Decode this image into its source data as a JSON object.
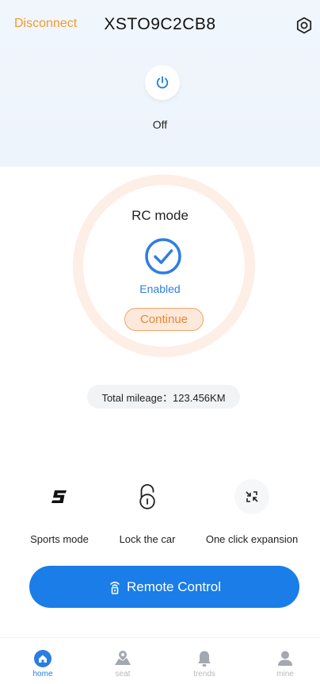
{
  "header": {
    "disconnect_label": "Disconnect",
    "device_id": "XSTO9C2CB8"
  },
  "power": {
    "state": "Off"
  },
  "rc_panel": {
    "title": "RC mode",
    "status": "Enabled",
    "continue_label": "Continue"
  },
  "mileage": {
    "text": "Total mileage：123.456KM"
  },
  "features": [
    {
      "label": "Sports mode",
      "icon": "sports-mode-icon"
    },
    {
      "label": "Lock the car",
      "icon": "lock-icon"
    },
    {
      "label": "One click expansion",
      "icon": "expand-icon"
    }
  ],
  "remote": {
    "label": "Remote Control",
    "icon": "remote-icon"
  },
  "tabs": [
    {
      "label": "home",
      "icon": "home-icon",
      "active": true
    },
    {
      "label": "seat",
      "icon": "map-icon"
    },
    {
      "label": "trends",
      "icon": "bell-icon"
    },
    {
      "label": "mine",
      "icon": "user-icon"
    }
  ],
  "colors": {
    "accent_orange": "#f39a2b",
    "primary_blue": "#1a7de8",
    "ring": "#fdeee6",
    "header_bg": "#f1f6fd"
  }
}
